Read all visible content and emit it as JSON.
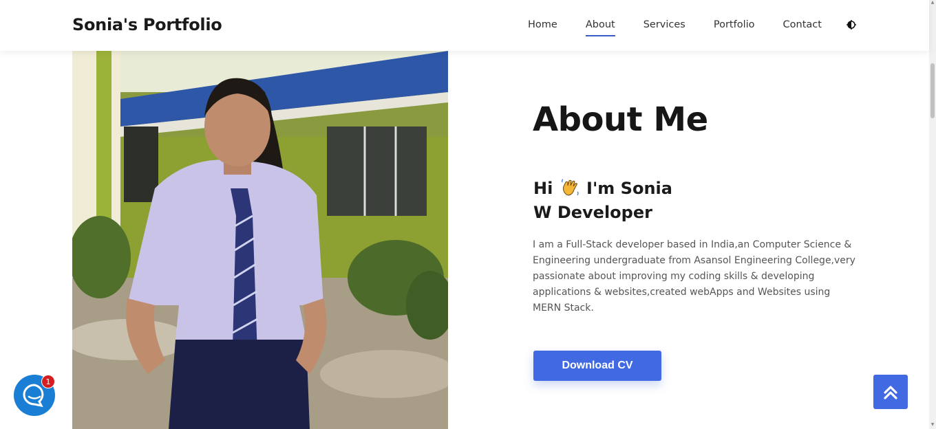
{
  "navbar": {
    "brand": "Sonia's Portfolio",
    "links": [
      "Home",
      "About",
      "Services",
      "Portfolio",
      "Contact"
    ],
    "active_link": "About",
    "theme_toggle_icon": "theme-toggle-icon"
  },
  "about": {
    "title": "About Me",
    "greeting_hi": "Hi",
    "greeting_name": "I'm Sonia",
    "role": "W Developer",
    "bio": "I am a Full-Stack developer based in India,an Computer Science & Engineering undergraduate from Asansol Engineering College,very passionate about improving my coding skills & developing applications & websites,created webApps and Websites using MERN Stack.",
    "cv_button": "Download CV"
  },
  "chat": {
    "badge_count": "1",
    "icon": "chat-icon"
  },
  "colors": {
    "accent": "#4169e1",
    "chat": "#1a7fd4",
    "badge": "#d31f1f"
  }
}
